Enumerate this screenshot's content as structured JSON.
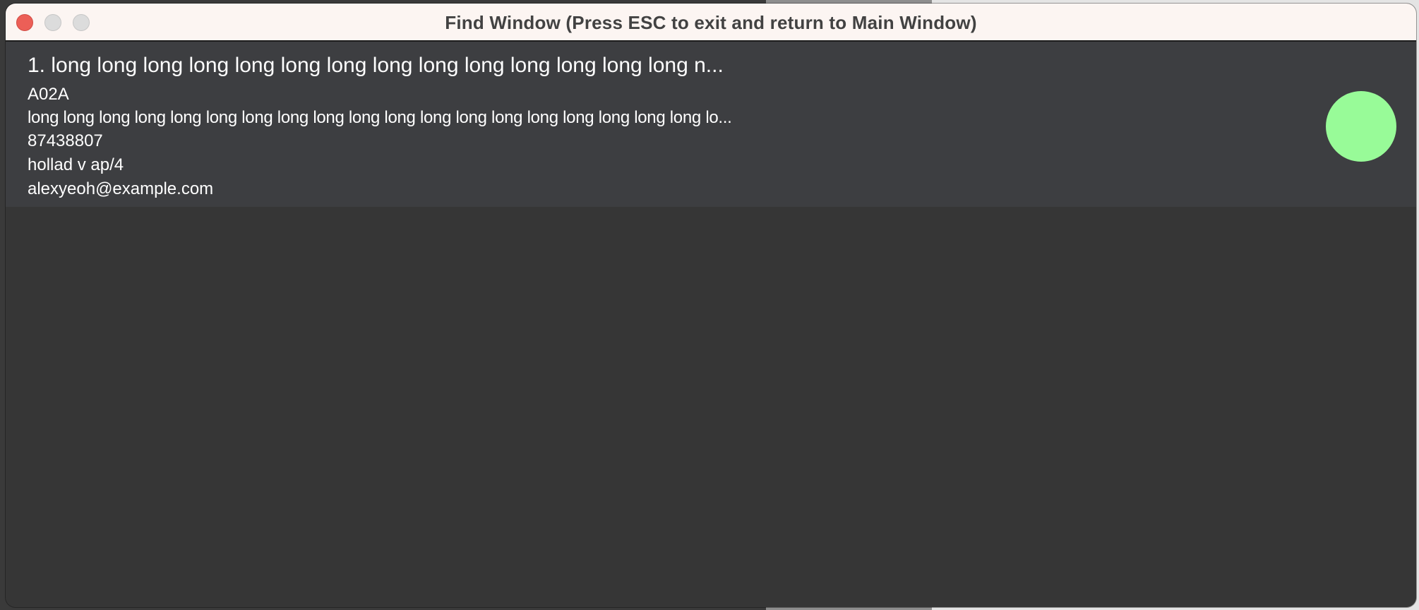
{
  "window": {
    "title": "Find Window (Press ESC to exit and return to Main Window)"
  },
  "results": [
    {
      "name": "1. long long long long long long long long long long long long long long n...",
      "code": "A02A",
      "description": "long long long long long long long long long long long long long long long long long long long lo...",
      "phone": "87438807",
      "address": "hollad v ap/4",
      "email": "alexyeoh@example.com",
      "status_color": "#98fb98"
    }
  ]
}
